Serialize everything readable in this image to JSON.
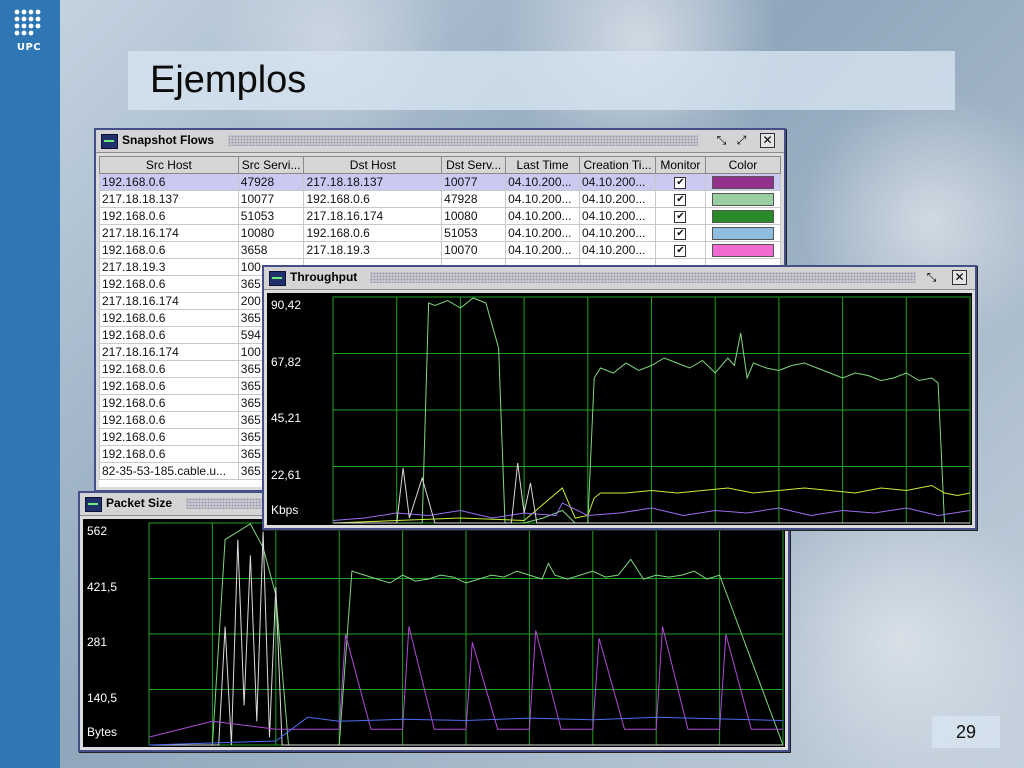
{
  "slide": {
    "logo_text": "UPC",
    "title": "Ejemplos",
    "slide_number": "29"
  },
  "colors": {
    "sidebar": "#2e77b4",
    "plot_background": "#000000",
    "grid": "#1fa11f",
    "window_border": "#444f88",
    "selected_row": "#c9c9f2"
  },
  "snapshot_window": {
    "title": "Snapshot Flows",
    "icon": "flows-window-icon",
    "buttons": [
      "minimize-icon",
      "maximize-icon",
      "close-icon"
    ],
    "columns": [
      "Src Host",
      "Src Servi...",
      "Dst Host",
      "Dst Serv...",
      "Last Time",
      "Creation Ti...",
      "Monitor",
      "Color"
    ],
    "rows": [
      {
        "src_host": "192.168.0.6",
        "src_serv": "47928",
        "dst_host": "217.18.18.137",
        "dst_serv": "10077",
        "last_time": "04.10.200...",
        "creation": "04.10.200...",
        "monitor": true,
        "color": "#93318a",
        "selected": true
      },
      {
        "src_host": "217.18.18.137",
        "src_serv": "10077",
        "dst_host": "192.168.0.6",
        "dst_serv": "47928",
        "last_time": "04.10.200...",
        "creation": "04.10.200...",
        "monitor": true,
        "color": "#97cfa2",
        "selected": false
      },
      {
        "src_host": "192.168.0.6",
        "src_serv": "51053",
        "dst_host": "217.18.16.174",
        "dst_serv": "10080",
        "last_time": "04.10.200...",
        "creation": "04.10.200...",
        "monitor": true,
        "color": "#2a8a2a",
        "selected": false
      },
      {
        "src_host": "217.18.16.174",
        "src_serv": "10080",
        "dst_host": "192.168.0.6",
        "dst_serv": "51053",
        "last_time": "04.10.200...",
        "creation": "04.10.200...",
        "monitor": true,
        "color": "#8fbde0",
        "selected": false
      },
      {
        "src_host": "192.168.0.6",
        "src_serv": "3658",
        "dst_host": "217.18.19.3",
        "dst_serv": "10070",
        "last_time": "04.10.200...",
        "creation": "04.10.200...",
        "monitor": true,
        "color": "#f06ad0",
        "selected": false
      },
      {
        "src_host": "217.18.19.3",
        "src_serv": "100",
        "dst_host": "",
        "dst_serv": "",
        "last_time": "",
        "creation": "",
        "monitor": false,
        "color": "",
        "selected": false
      },
      {
        "src_host": "192.168.0.6",
        "src_serv": "365",
        "dst_host": "",
        "dst_serv": "",
        "last_time": "",
        "creation": "",
        "monitor": false,
        "color": "",
        "selected": false
      },
      {
        "src_host": "217.18.16.174",
        "src_serv": "200",
        "dst_host": "",
        "dst_serv": "",
        "last_time": "",
        "creation": "",
        "monitor": false,
        "color": "",
        "selected": false
      },
      {
        "src_host": "192.168.0.6",
        "src_serv": "365",
        "dst_host": "",
        "dst_serv": "",
        "last_time": "",
        "creation": "",
        "monitor": false,
        "color": "",
        "selected": false
      },
      {
        "src_host": "192.168.0.6",
        "src_serv": "594",
        "dst_host": "",
        "dst_serv": "",
        "last_time": "",
        "creation": "",
        "monitor": false,
        "color": "",
        "selected": false
      },
      {
        "src_host": "217.18.16.174",
        "src_serv": "100",
        "dst_host": "",
        "dst_serv": "",
        "last_time": "",
        "creation": "",
        "monitor": false,
        "color": "",
        "selected": false
      },
      {
        "src_host": "192.168.0.6",
        "src_serv": "365",
        "dst_host": "",
        "dst_serv": "",
        "last_time": "",
        "creation": "",
        "monitor": false,
        "color": "",
        "selected": false
      },
      {
        "src_host": "192.168.0.6",
        "src_serv": "365",
        "dst_host": "",
        "dst_serv": "",
        "last_time": "",
        "creation": "",
        "monitor": false,
        "color": "",
        "selected": false
      },
      {
        "src_host": "192.168.0.6",
        "src_serv": "365",
        "dst_host": "",
        "dst_serv": "",
        "last_time": "",
        "creation": "",
        "monitor": false,
        "color": "",
        "selected": false
      },
      {
        "src_host": "192.168.0.6",
        "src_serv": "365",
        "dst_host": "",
        "dst_serv": "",
        "last_time": "",
        "creation": "",
        "monitor": false,
        "color": "",
        "selected": false
      },
      {
        "src_host": "192.168.0.6",
        "src_serv": "365",
        "dst_host": "",
        "dst_serv": "",
        "last_time": "",
        "creation": "",
        "monitor": false,
        "color": "",
        "selected": false
      },
      {
        "src_host": "192.168.0.6",
        "src_serv": "365",
        "dst_host": "",
        "dst_serv": "",
        "last_time": "",
        "creation": "",
        "monitor": false,
        "color": "",
        "selected": false
      },
      {
        "src_host": "82-35-53-185.cable.u...",
        "src_serv": "365",
        "dst_host": "",
        "dst_serv": "",
        "last_time": "",
        "creation": "",
        "monitor": false,
        "color": "",
        "selected": false
      }
    ]
  },
  "throughput_window": {
    "title": "Throughput",
    "icon": "chart-window-icon",
    "buttons": [
      "minimize-icon",
      "close-icon"
    ]
  },
  "packet_window": {
    "title": "Packet Size",
    "icon": "chart-window-icon"
  },
  "chart_data": [
    {
      "type": "line",
      "title": "Throughput",
      "unit_label": "Kbps",
      "y_ticks": [
        "90,42",
        "67,82",
        "45,21",
        "22,61"
      ],
      "ylim": [
        0,
        90.42
      ],
      "xlim": [
        0,
        100
      ],
      "grid": true,
      "series": [
        {
          "color": "#7fd67f",
          "x": [
            0,
            5,
            10,
            14,
            15,
            16,
            18,
            20,
            22,
            24,
            26,
            27,
            28,
            30,
            33,
            36,
            38,
            40,
            41,
            42,
            44,
            46,
            48,
            50,
            52,
            54,
            56,
            58,
            60,
            62,
            63,
            64,
            65,
            66,
            68,
            70,
            72,
            74,
            76,
            78,
            80,
            82,
            84,
            86,
            88,
            90,
            92,
            94,
            95,
            96,
            100
          ],
          "y": [
            0,
            0,
            0,
            0,
            88,
            87,
            89,
            86,
            90,
            88,
            70,
            0,
            0,
            0,
            2,
            5,
            0,
            0,
            58,
            62,
            60,
            64,
            61,
            63,
            66,
            64,
            62,
            65,
            60,
            66,
            63,
            76,
            58,
            64,
            62,
            61,
            63,
            64,
            62,
            60,
            58,
            60,
            59,
            57,
            58,
            60,
            57,
            58,
            56,
            0,
            0
          ]
        },
        {
          "color": "#c6f03a",
          "x": [
            0,
            10,
            20,
            30,
            36,
            38,
            40,
            41,
            42,
            46,
            50,
            54,
            58,
            62,
            66,
            70,
            74,
            78,
            82,
            86,
            90,
            94,
            96,
            98,
            100
          ],
          "y": [
            0,
            1,
            2,
            1,
            14,
            2,
            3,
            10,
            12,
            12,
            13,
            12,
            13,
            14,
            12,
            13,
            14,
            13,
            12,
            14,
            13,
            15,
            12,
            11,
            12
          ]
        },
        {
          "color": "#9b6bf0",
          "x": [
            0,
            5,
            10,
            15,
            20,
            25,
            30,
            35,
            36,
            40,
            45,
            50,
            55,
            60,
            65,
            70,
            75,
            80,
            85,
            90,
            95,
            100
          ],
          "y": [
            1,
            2,
            4,
            3,
            5,
            2,
            4,
            3,
            8,
            3,
            4,
            6,
            3,
            5,
            4,
            6,
            3,
            5,
            4,
            6,
            3,
            5
          ]
        },
        {
          "color": "#d8d8d8",
          "x": [
            0,
            10,
            11,
            12,
            14,
            16,
            20,
            28,
            29,
            30,
            31,
            32,
            34,
            100
          ],
          "y": [
            0,
            0,
            22,
            2,
            18,
            0,
            0,
            0,
            24,
            4,
            16,
            0,
            0,
            0
          ]
        }
      ]
    },
    {
      "type": "line",
      "title": "Packet Size",
      "unit_label": "Bytes",
      "y_ticks": [
        "562",
        "421,5",
        "281",
        "140,5"
      ],
      "ylim": [
        0,
        562
      ],
      "xlim": [
        0,
        100
      ],
      "grid": true,
      "series": [
        {
          "color": "#7fd67f",
          "x": [
            0,
            10,
            12,
            14,
            16,
            18,
            20,
            22,
            24,
            26,
            28,
            30,
            32,
            34,
            36,
            38,
            40,
            42,
            44,
            46,
            48,
            50,
            52,
            54,
            56,
            58,
            60,
            62,
            63,
            64,
            66,
            68,
            70,
            72,
            74,
            76,
            78,
            80,
            82,
            84,
            86,
            88,
            90,
            100
          ],
          "y": [
            0,
            0,
            520,
            540,
            560,
            500,
            380,
            0,
            0,
            0,
            0,
            0,
            440,
            430,
            420,
            410,
            430,
            415,
            420,
            430,
            425,
            410,
            420,
            430,
            425,
            440,
            430,
            420,
            460,
            430,
            420,
            430,
            440,
            425,
            430,
            470,
            420,
            430,
            425,
            430,
            440,
            420,
            430,
            0
          ]
        },
        {
          "color": "#dcdcdc",
          "x": [
            0,
            11,
            12,
            13,
            14,
            15,
            16,
            17,
            18,
            19,
            20,
            21,
            22,
            24,
            100
          ],
          "y": [
            0,
            0,
            300,
            0,
            520,
            100,
            480,
            60,
            540,
            20,
            400,
            0,
            0,
            0,
            0
          ]
        },
        {
          "color": "#b04ad6",
          "x": [
            0,
            10,
            20,
            30,
            31,
            35,
            40,
            41,
            45,
            50,
            51,
            55,
            60,
            61,
            65,
            70,
            71,
            75,
            80,
            81,
            85,
            90,
            91,
            95,
            100
          ],
          "y": [
            20,
            60,
            40,
            40,
            280,
            40,
            40,
            300,
            40,
            40,
            260,
            40,
            40,
            290,
            40,
            40,
            270,
            40,
            40,
            300,
            40,
            40,
            280,
            40,
            40
          ]
        },
        {
          "color": "#4a6cf0",
          "x": [
            0,
            20,
            25,
            30,
            40,
            50,
            60,
            70,
            80,
            90,
            100
          ],
          "y": [
            0,
            10,
            70,
            60,
            65,
            62,
            68,
            64,
            70,
            66,
            62
          ]
        }
      ]
    }
  ]
}
